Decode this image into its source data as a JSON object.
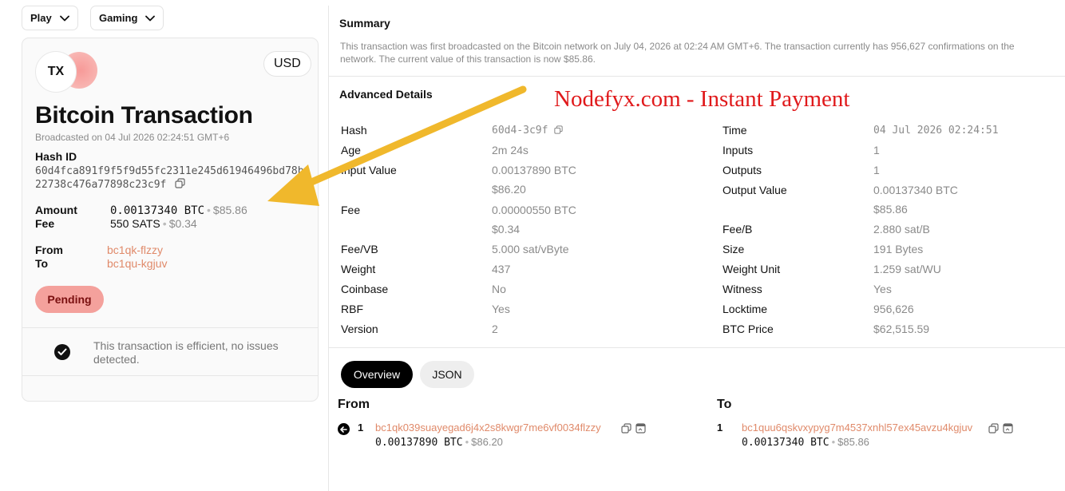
{
  "top_nav": {
    "play_label": "Play",
    "gaming_label": "Gaming"
  },
  "card": {
    "logo_text": "TX",
    "currency_button": "USD",
    "title": "Bitcoin Transaction",
    "broadcast_text": "Broadcasted on 04 Jul 2026 02:24:51 GMT+6",
    "hash_label": "Hash ID",
    "hash_value": "60d4fca891f9f5f9d55fc2311e245d61946496bd78b22738c476a77898c23c9f",
    "amount_label": "Amount",
    "amount_btc": "0.00137340 BTC",
    "amount_usd": "$85.86",
    "fee_label": "Fee",
    "fee_sats": "550 SATS",
    "fee_usd": "$0.34",
    "from_label": "From",
    "from_value": "bc1qk-flzzy",
    "to_label": "To",
    "to_value": "bc1qu-kgjuv",
    "status_badge": "Pending",
    "efficiency_text": "This transaction is efficient, no issues detected."
  },
  "summary": {
    "heading": "Summary",
    "line1": "This transaction was first broadcasted on the Bitcoin network on July 04, 2026 at 02:24 AM GMT+6. The transaction currently has 956,627 confirmations on the",
    "line2": "network. The current value of this transaction is now $85.86."
  },
  "advanced": {
    "heading": "Advanced Details",
    "left_rows": [
      {
        "key": "Hash",
        "value": "60d4-3c9f"
      },
      {
        "key": "Age",
        "value": "2m 24s"
      },
      {
        "key": "Input Value",
        "value": "0.00137890 BTC",
        "sub": "$86.20"
      },
      {
        "key": "Fee",
        "value": "0.00000550 BTC",
        "sub": "$0.34"
      },
      {
        "key": "Fee/VB",
        "value": "5.000 sat/vByte"
      },
      {
        "key": "Weight",
        "value": "437"
      },
      {
        "key": "Coinbase",
        "value": "No"
      },
      {
        "key": "RBF",
        "value": "Yes"
      },
      {
        "key": "Version",
        "value": "2"
      }
    ],
    "right_rows": [
      {
        "key": "Time",
        "value": "04 Jul 2026 02:24:51"
      },
      {
        "key": "Inputs",
        "value": "1"
      },
      {
        "key": "Outputs",
        "value": "1"
      },
      {
        "key": "Output Value",
        "value": "0.00137340 BTC",
        "sub": "$85.86"
      },
      {
        "key": "Fee/B",
        "value": "2.880 sat/B"
      },
      {
        "key": "Size",
        "value": "191 Bytes"
      },
      {
        "key": "Weight Unit",
        "value": "1.259 sat/WU"
      },
      {
        "key": "Witness",
        "value": "Yes"
      },
      {
        "key": "Locktime",
        "value": "956,626"
      },
      {
        "key": "BTC Price",
        "value": "$62,515.59"
      }
    ]
  },
  "watermark_text": "Nodefyx.com - Instant Payment",
  "tabs": {
    "overview": "Overview",
    "json": "JSON"
  },
  "io": {
    "from_heading": "From",
    "to_heading": "To",
    "input": {
      "index": "1",
      "address": "bc1qk039suayegad6j4x2s8kwgr7me6vf0034flzzy",
      "btc": "0.00137890 BTC",
      "usd": "$86.20"
    },
    "output": {
      "index": "1",
      "address": "bc1quu6qskvxypyg7m4537xnhl57ex45avzu4kgjuv",
      "btc": "0.00137340 BTC",
      "usd": "$85.86"
    }
  },
  "colors": {
    "accent_address": "#e08a6a",
    "pending_bg": "#f4a19c",
    "watermark": "#e0191b",
    "arrow": "#f0b82c"
  }
}
